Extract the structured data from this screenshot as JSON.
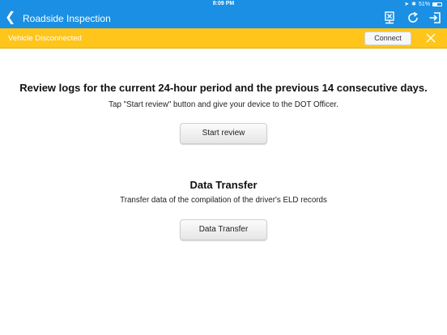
{
  "status_bar": {
    "time": "8:09 PM",
    "battery": "51%",
    "battery_level": 0.51
  },
  "nav": {
    "title": "Roadside Inspection"
  },
  "banner": {
    "text": "Vehicle Disconnected",
    "connect_label": "Connect"
  },
  "review": {
    "heading": "Review logs for the current 24-hour period and the previous 14 consecutive days.",
    "instruction": "Tap \"Start review\" button and give your device to the DOT Officer.",
    "button_label": "Start review"
  },
  "transfer": {
    "heading": "Data Transfer",
    "description": "Transfer data of the compilation of the driver's ELD records",
    "button_label": "Data Transfer"
  },
  "colors": {
    "nav": "#1a8fe3",
    "banner": "#ffc51a"
  }
}
